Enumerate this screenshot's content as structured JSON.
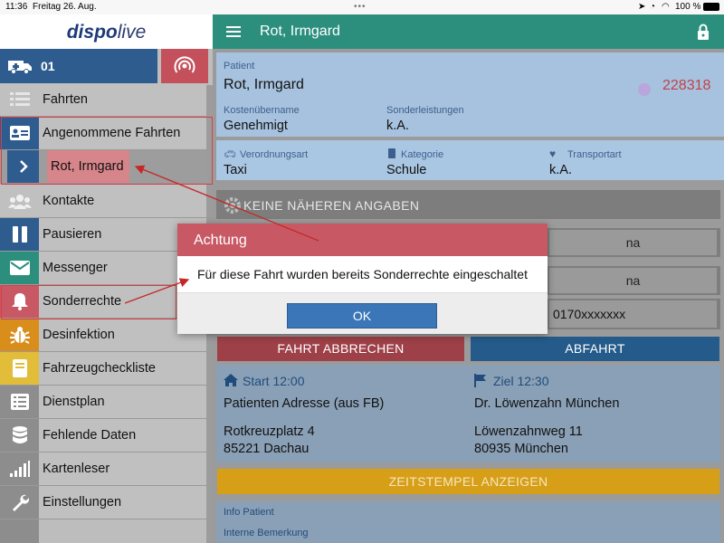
{
  "statusbar": {
    "time": "11:36",
    "date": "Freitag 26. Aug.",
    "battery": "100 %"
  },
  "sidebar": {
    "logo_main": "dispo",
    "logo_accent": "live",
    "vehicle_number": "01",
    "items": [
      {
        "label": "Fahrten",
        "icon": "list-icon"
      },
      {
        "label": "Angenommene Fahrten",
        "icon": "id-card-icon"
      },
      {
        "label": "Rot, Irmgard",
        "icon": "chevron-right-icon"
      },
      {
        "label": "Kontakte",
        "icon": "users-icon"
      },
      {
        "label": "Pausieren",
        "icon": "pause-icon"
      },
      {
        "label": "Messenger",
        "icon": "envelope-icon"
      },
      {
        "label": "Sonderrechte",
        "icon": "bell-icon"
      },
      {
        "label": "Desinfektion",
        "icon": "bug-icon"
      },
      {
        "label": "Fahrzeugcheckliste",
        "icon": "book-icon"
      },
      {
        "label": "Dienstplan",
        "icon": "list-alt-icon"
      },
      {
        "label": "Fehlende Daten",
        "icon": "database-icon"
      },
      {
        "label": "Kartenleser",
        "icon": "signal-icon"
      },
      {
        "label": "Einstellungen",
        "icon": "wrench-icon"
      }
    ]
  },
  "header": {
    "title": "Rot, Irmgard"
  },
  "patient": {
    "label": "Patient",
    "name": "Rot, Irmgard",
    "id": "228318",
    "kosten_label": "Kostenübername",
    "kosten_value": "Genehmigt",
    "sonder_label": "Sonderleistungen",
    "sonder_value": "k.A."
  },
  "transport": {
    "verordnung_label": "Verordnungsart",
    "verordnung_value": "Taxi",
    "kategorie_label": "Kategorie",
    "kategorie_value": "Schule",
    "transportart_label": "Transportart",
    "transportart_value": "k.A."
  },
  "info_bar": "KEINE NÄHEREN ANGABEN",
  "fields": {
    "na1": "na",
    "na2": "na",
    "phone": "0170xxxxxxx"
  },
  "buttons": {
    "cancel": "FAHRT ABBRECHEN",
    "depart": "ABFAHRT",
    "timestamps": "ZEITSTEMPEL ANZEIGEN"
  },
  "route": {
    "start_label": "Start 12:00",
    "start_name": "Patienten Adresse (aus FB)",
    "start_street": "Rotkreuzplatz 4",
    "start_city": "85221 Dachau",
    "ziel_label": "Ziel 12:30",
    "ziel_name": "Dr. Löwenzahn München",
    "ziel_street": "Löwenzahnweg 11",
    "ziel_city": "80935 München"
  },
  "info": {
    "patient_label": "Info Patient",
    "remark_label": "Interne Bemerkung"
  },
  "modal": {
    "title": "Achtung",
    "message": "Für diese Fahrt wurden bereits Sonderrechte eingeschaltet",
    "ok": "OK"
  }
}
